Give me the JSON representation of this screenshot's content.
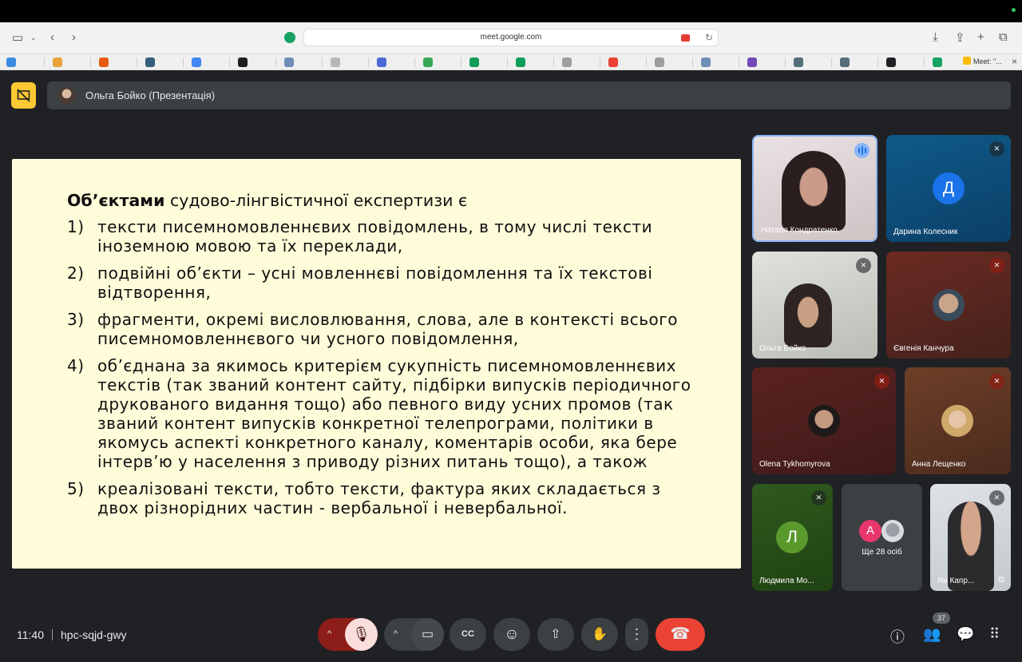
{
  "browser": {
    "url": "meet.google.com",
    "bookmark_tab": "Meet: \"...",
    "bookmark_colors": [
      "#3b8be0",
      "#e8a33a",
      "#e55b13",
      "#35607b",
      "#4285f4",
      "#1f1f1f",
      "#6f8fb7",
      "#b7b7b7",
      "#4d6ad9",
      "#34a853",
      "#0f9d58",
      "#0f9d58",
      "#9e9e9e",
      "#ea4335",
      "#9e9e9e",
      "#6f8fb7",
      "#7248b9",
      "#546e7a",
      "#546e7a",
      "#202124",
      "#15a35f"
    ]
  },
  "presenter": {
    "name": "Ольга Бойко (Презентація)"
  },
  "slide": {
    "heading_bold": "Об’єктами",
    "heading_rest": " судово-лінгвістичної експертизи є",
    "items": [
      {
        "num": "1)",
        "text": "тексти писемномовленнєвих повідомлень, в тому числі тексти іноземною мовою та їх переклади,"
      },
      {
        "num": "2)",
        "text": "подвійні об’єкти – усні мовленнєві повідомлення та їх текстові відтворення,"
      },
      {
        "num": "3)",
        "text": "фрагменти, окремі висловлювання, слова, але в контексті всього писемномовленнєвого чи усного повідомлення,"
      },
      {
        "num": "4)",
        "text": "об’єднана за якимось критерієм сукупність писемномовленнєвих текстів (так званий контент сайту, підбірки випусків періодичного друкованого видання тощо) або певного виду усних промов (так званий контент випусків конкретної телепрограми, політики в якомусь аспекті конкретного каналу, коментарів особи, яка бере інтерв’ю у населення з приводу різних питань тощо), а також"
      },
      {
        "num": "5)",
        "text": "креалізовані тексти, тобто тексти, фактура яких складається з двох різнорідних частин - вербальної і невербальної."
      }
    ]
  },
  "participants": [
    {
      "name": "Наталя Кондратенко"
    },
    {
      "name": "Дарина Колесник",
      "initial": "Д"
    },
    {
      "name": "Ольга Бойко"
    },
    {
      "name": "Євгенія Канчура"
    },
    {
      "name": "Olena Tykhomyrova"
    },
    {
      "name": "Анна Лещенко"
    },
    {
      "name": "Людмила Мо...",
      "initial": "Л"
    },
    {
      "name": "Ще 28 осіб",
      "initial": "А"
    },
    {
      "name": "Ян Капр..."
    }
  ],
  "meeting": {
    "time": "11:40",
    "code": "hpc-sqjd-gwy",
    "people_count": "37"
  }
}
